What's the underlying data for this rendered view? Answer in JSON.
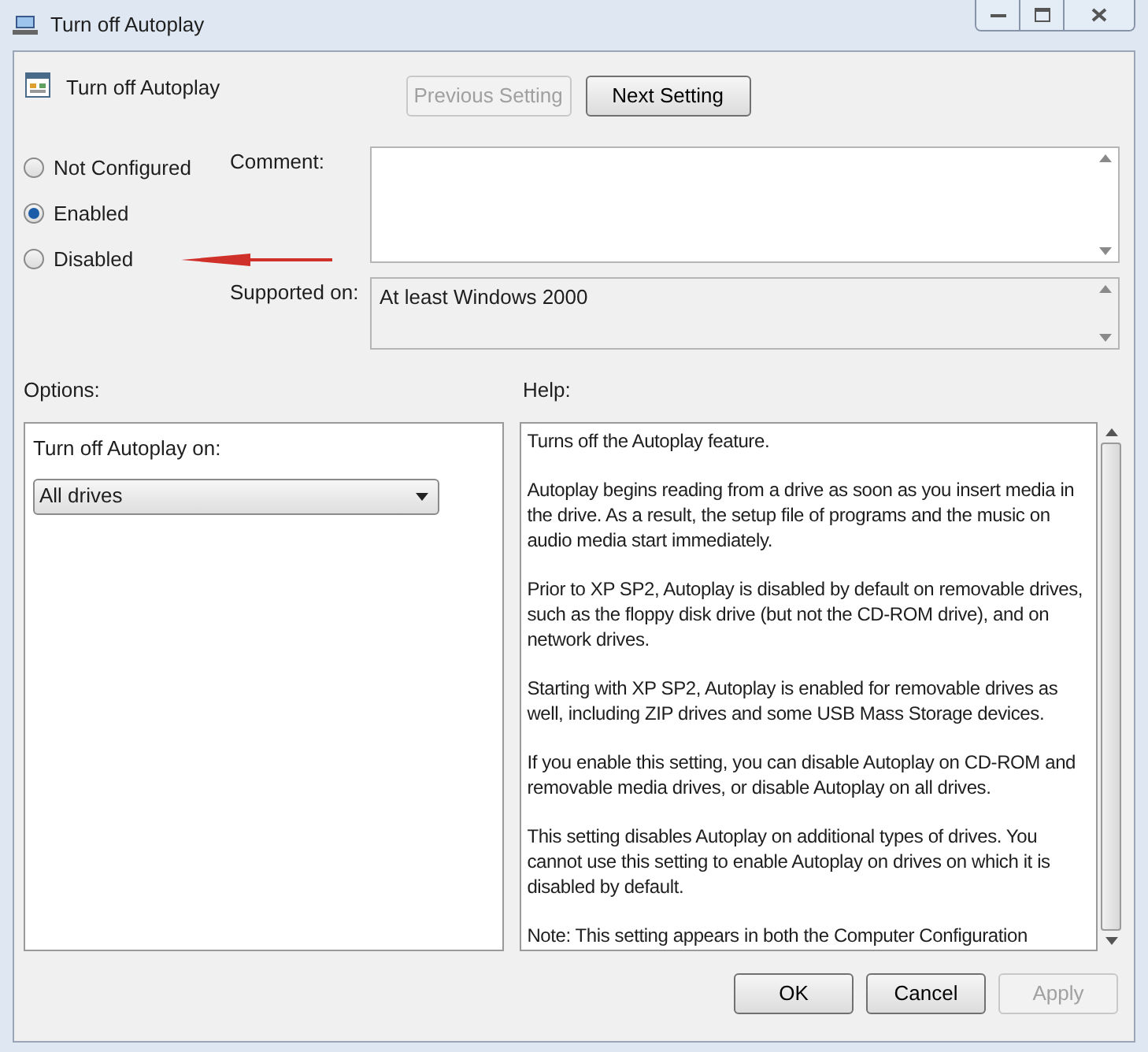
{
  "window": {
    "title": "Turn off Autoplay"
  },
  "policy": {
    "title": "Turn off Autoplay"
  },
  "nav_buttons": [
    {
      "label": "Previous Setting",
      "disabled": true
    },
    {
      "label": "Next Setting",
      "disabled": false
    }
  ],
  "radios": [
    {
      "label": "Not Configured",
      "selected": false
    },
    {
      "label": "Enabled",
      "selected": true
    },
    {
      "label": "Disabled",
      "selected": false
    }
  ],
  "comment": {
    "label": "Comment:"
  },
  "supported": {
    "label": "Supported on:",
    "value": "At least Windows 2000"
  },
  "options": {
    "label": "Options:",
    "field_label": "Turn off Autoplay on:",
    "dropdown": "All drives"
  },
  "help": {
    "label": "Help:",
    "paragraphs": [
      "Turns off the Autoplay feature.",
      "Autoplay begins reading from a drive as soon as you insert media in the drive. As a result, the setup file of programs and the music on audio media start immediately.",
      "Prior to XP SP2, Autoplay is disabled by default on removable drives, such as the floppy disk drive (but not the CD-ROM drive), and on network drives.",
      "Starting with XP SP2, Autoplay is enabled for removable drives as well, including ZIP drives and some USB Mass Storage devices.",
      "If you enable this setting, you can disable Autoplay on CD-ROM and removable media drives, or disable Autoplay on all drives.",
      "This setting disables Autoplay on additional types of drives. You cannot use this setting to enable Autoplay on drives on which it is disabled by default.",
      "Note: This setting appears in both the Computer Configuration"
    ]
  },
  "buttons": [
    {
      "label": "OK",
      "disabled": false
    },
    {
      "label": "Cancel",
      "disabled": false
    },
    {
      "label": "Apply",
      "disabled": true
    }
  ]
}
